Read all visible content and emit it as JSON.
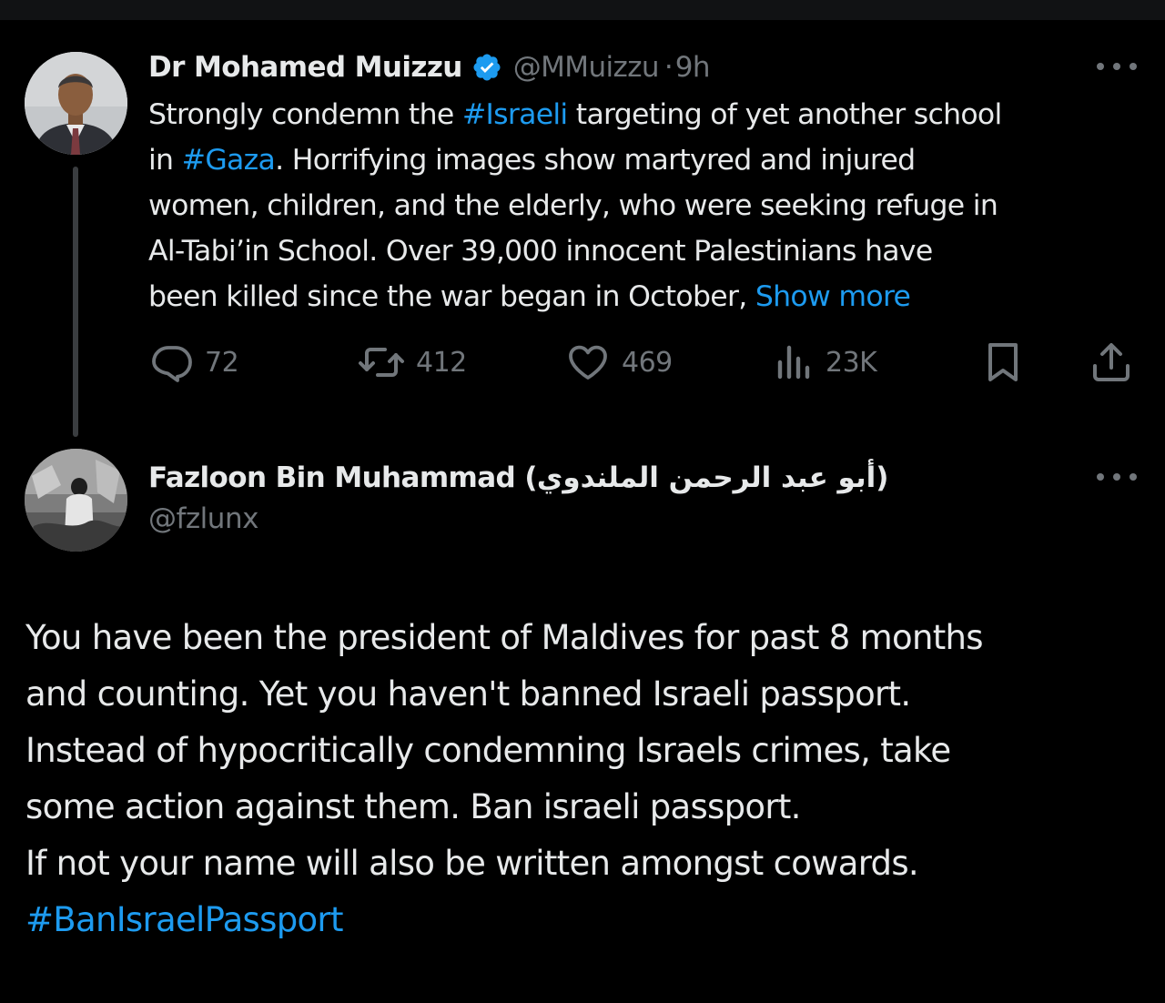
{
  "tweet": {
    "author_name": "Dr Mohamed Muizzu",
    "handle": "@MMuizzu",
    "separator": "·",
    "time": "9h",
    "text_lines": [
      [
        "Strongly condemn the ",
        "#Israeli",
        " targeting of yet another school"
      ],
      [
        "in ",
        "#Gaza",
        ". Horrifying images show martyred and injured"
      ],
      [
        "women, children, and the elderly, who were seeking refuge in"
      ],
      [
        "Al-Tabi’in School. Over 39,000 innocent Palestinians have"
      ],
      [
        "been killed since the war began in October, ",
        "Show more"
      ]
    ],
    "actions": {
      "replies": "72",
      "reposts": "412",
      "likes": "469",
      "views": "23K"
    }
  },
  "reply": {
    "author_name": "Fazloon Bin Muhammad (أبو عبد الرحمن الملندوي)",
    "handle": "@fzlunx",
    "text_lines": [
      "You have been the president of Maldives for past 8 months",
      "and counting. Yet you haven't banned Israeli passport.",
      "Instead of hypocritically condemning Israels crimes, take",
      "some action against them. Ban israeli passport.",
      "If not your name will also be written amongst cowards.",
      "#BanIsraelPassport"
    ]
  },
  "colors": {
    "background": "#000000",
    "text": "#e7e9ea",
    "muted": "#71767b",
    "link": "#1d9bf0",
    "verified": "#1d9bf0"
  },
  "icons": [
    "more-icon",
    "verified-badge-icon",
    "reply-icon",
    "repost-icon",
    "like-icon",
    "views-icon",
    "bookmark-icon",
    "share-icon"
  ]
}
